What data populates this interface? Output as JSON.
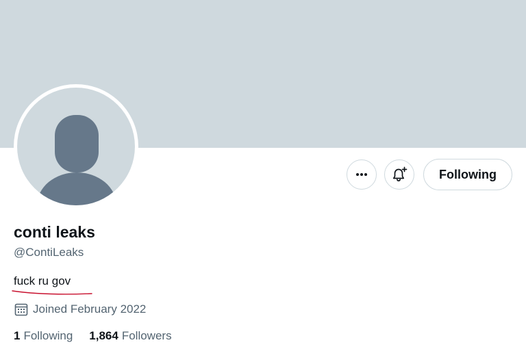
{
  "profile": {
    "display_name": "conti leaks",
    "handle": "@ContiLeaks",
    "bio": "fuck ru gov",
    "joined": "Joined February 2022"
  },
  "actions": {
    "more_icon": "more-horizontal-icon",
    "notify_icon": "bell-plus-icon",
    "following_label": "Following"
  },
  "stats": {
    "following_count": "1",
    "following_label": "Following",
    "followers_count": "1,864",
    "followers_label": "Followers"
  },
  "colors": {
    "banner": "#cfd9de",
    "avatar_placeholder": "#cfd9de",
    "avatar_silhouette": "#66788a",
    "primary_text": "#0f1419",
    "secondary_text": "#536471",
    "border": "#cfd9de",
    "bio_underline": "#c8102e"
  }
}
